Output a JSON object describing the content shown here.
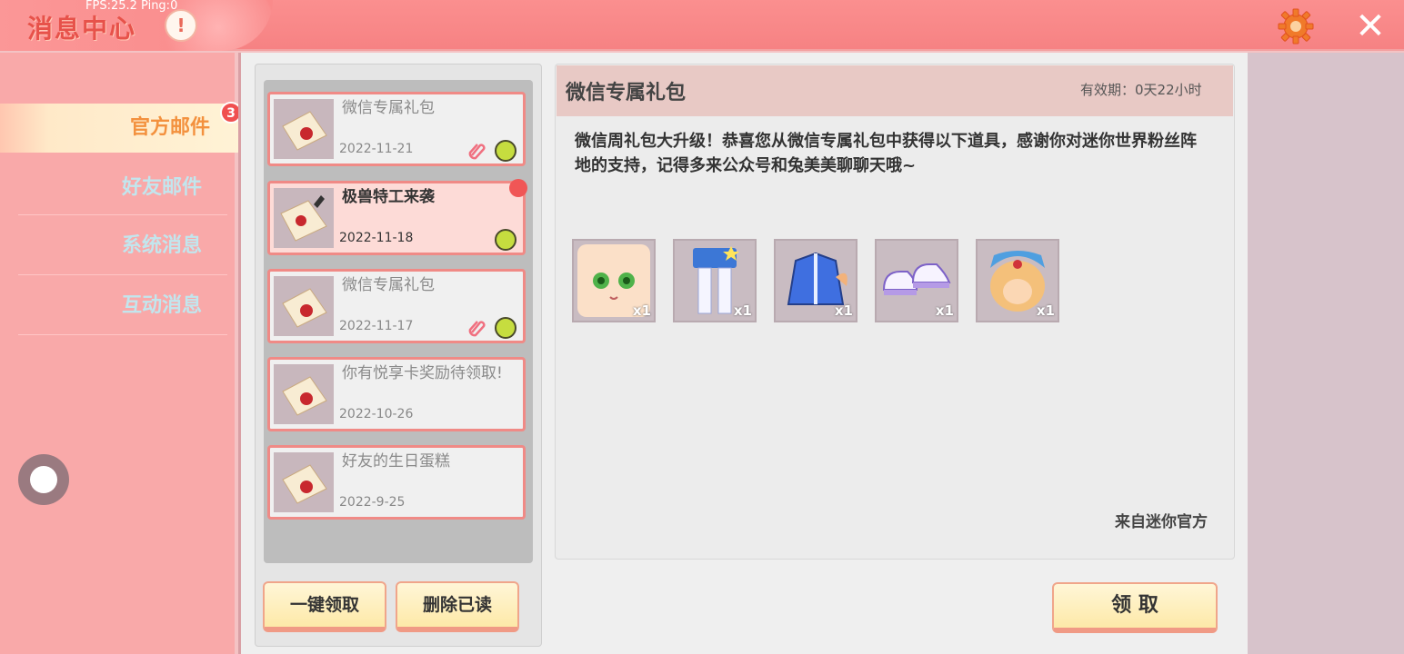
{
  "header": {
    "fps_text": "FPS:25.2  Ping:0",
    "title": "消息中心",
    "info_glyph": "!",
    "close_glyph": "✕"
  },
  "sidebar": {
    "badge": "3",
    "items": [
      {
        "label": "官方邮件",
        "active": true
      },
      {
        "label": "好友邮件",
        "active": false
      },
      {
        "label": "系统消息",
        "active": false
      },
      {
        "label": "互动消息",
        "active": false
      }
    ]
  },
  "mail_list": [
    {
      "title": "微信专属礼包",
      "date": "2022-11-21",
      "state": "read",
      "has_attachment": true,
      "timed": true
    },
    {
      "title": "极兽特工来袭",
      "date": "2022-11-18",
      "state": "unread",
      "has_attachment": false,
      "timed": true
    },
    {
      "title": "微信专属礼包",
      "date": "2022-11-17",
      "state": "read",
      "has_attachment": true,
      "timed": true
    },
    {
      "title": "你有悦享卡奖励待领取!",
      "date": "2022-10-26",
      "state": "read",
      "has_attachment": false,
      "timed": false
    },
    {
      "title": "好友的生日蛋糕",
      "date": "2022-9-25",
      "state": "read",
      "has_attachment": false,
      "timed": false
    }
  ],
  "buttons": {
    "claim_all": "一键领取",
    "delete_read": "删除已读",
    "claim": "领 取"
  },
  "detail": {
    "title": "微信专属礼包",
    "validity": "有效期：0天22小时",
    "body": "微信周礼包大升级！恭喜您从微信专属礼包中获得以下道具，感谢你对迷你世界粉丝阵地的支持，记得多来公众号和兔美美聊聊天哦~",
    "from": "来自迷你官方",
    "rewards": [
      {
        "icon": "face-icon",
        "qty": "x1"
      },
      {
        "icon": "pants-icon",
        "qty": "x1"
      },
      {
        "icon": "jacket-icon",
        "qty": "x1"
      },
      {
        "icon": "shoes-icon",
        "qty": "x1"
      },
      {
        "icon": "hair-icon",
        "qty": "x1"
      }
    ]
  },
  "colors": {
    "topbar": "#f68283",
    "accent_orange": "#f3913e",
    "card_border": "#f08a86"
  }
}
